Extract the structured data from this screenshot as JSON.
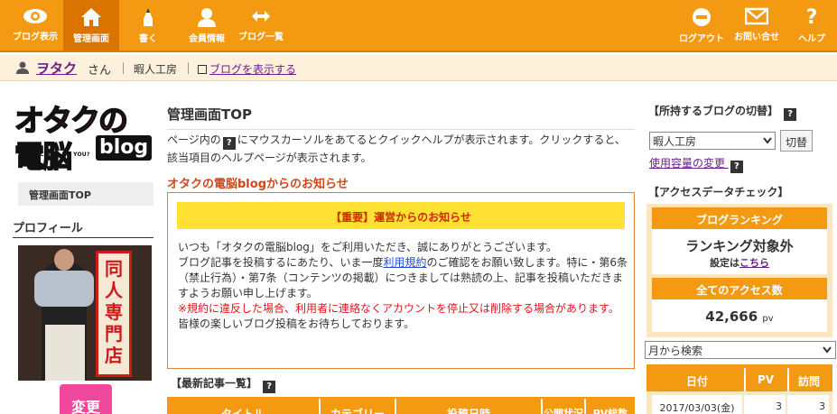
{
  "nav": {
    "left": [
      {
        "label": "ブログ表示",
        "icon": "eye-icon"
      },
      {
        "label": "管理画面",
        "icon": "home-icon"
      },
      {
        "label": "書く",
        "icon": "pencil-icon"
      },
      {
        "label": "会員情報",
        "icon": "person-icon"
      },
      {
        "label": "ブログ一覧",
        "icon": "swap-arrows-icon"
      }
    ],
    "right": [
      {
        "label": "ログアウト",
        "icon": "logout-icon"
      },
      {
        "label": "お問い合せ",
        "icon": "mail-icon"
      },
      {
        "label": "ヘルプ",
        "icon": "question-icon"
      }
    ]
  },
  "user": {
    "name": "ヲタク",
    "honorific": "さん",
    "workshop": "暇人工房",
    "view_blog_link": "ブログを表示する"
  },
  "left": {
    "logo": {
      "main": "オタクの電脳",
      "blog": "blog",
      "sub": "COLLECTION DO YOU?"
    },
    "menu_item": "管理画面TOP",
    "profile_heading": "プロフィール",
    "photo_sign": "同人専門店",
    "change_button": "変更"
  },
  "main": {
    "title": "管理画面TOP",
    "help_before": "ページ内の",
    "help_after": "にマウスカーソルをあてるとクイックヘルプが表示されます。クリックすると、該当項目のヘルプページが表示されます。",
    "notice_heading": "オタクの電脳blogからのお知らせ",
    "notice_banner": "【重要】運営からのお知らせ",
    "notice_line1": "いつも「オタクの電脳blog」をご利用いただき、誠にありがとうございます。",
    "notice_line2_before": "ブログ記事を投稿するにあたり、いま一度",
    "notice_terms_link": "利用規約",
    "notice_line2_after": "のご確認をお願い致します。特に・第6条（禁止行為）・第7条（コンテンツの掲載）につきましては熟読の上、記事を投稿いただきますようお願い申し上げます。",
    "notice_warning": "※規約に違反した場合、利用者に連絡なくアカウントを停止又は削除する場合があります。",
    "notice_closing": "皆様の楽しいブログ投稿をお待ちしております。",
    "recent_heading": "【最新記事一覧】",
    "recent_columns": [
      "タイトル",
      "カテゴリー",
      "投稿日時",
      "公開状況",
      "PV総数"
    ]
  },
  "right": {
    "blog_switch_heading": "【所持するブログの切替】",
    "blog_select_value": "暇人工房",
    "switch_button": "切替",
    "usage_link": "使用容量の変更",
    "access_heading": "【アクセスデータチェック】",
    "ranking_heading": "ブログランキング",
    "ranking_value": "ランキング対象外",
    "setting_prefix": "設定は",
    "setting_link": "こちら",
    "all_access_heading": "全てのアクセス数",
    "all_access_value": "42,666",
    "all_access_unit": "pv",
    "month_select": "月から検索",
    "stats_columns": [
      "日付",
      "PV",
      "訪問"
    ],
    "stats_rows": [
      {
        "date": "2017/03/03(金)",
        "pv": "3",
        "visits": "3"
      }
    ]
  }
}
